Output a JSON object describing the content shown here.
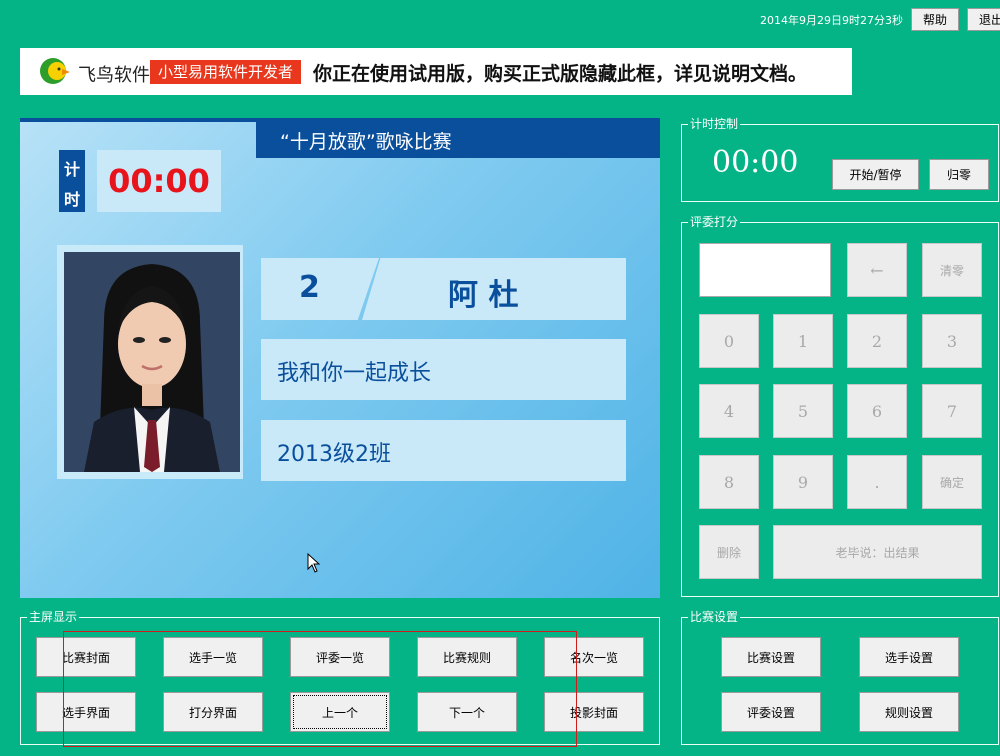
{
  "top": {
    "datetime": "2014年9月29日9时27分3秒",
    "help_label": "帮助",
    "exit_label": "退出"
  },
  "banner": {
    "logo_text": "飞鸟软件",
    "tagline": "小型易用软件开发者",
    "notice": "你正在使用试用版，购买正式版隐藏此框，详见说明文档。"
  },
  "stage": {
    "title": "“十月放歌”歌咏比赛",
    "timer_label_1": "计",
    "timer_label_2": "时",
    "timer_value": "00:00",
    "contestant_number": "2",
    "contestant_name": "阿 杜",
    "song": "我和你一起成长",
    "class": "2013级2班"
  },
  "timer_control": {
    "group_title": "计时控制",
    "display": "00:00",
    "start_pause_label": "开始/暂停",
    "reset_label": "归零"
  },
  "judge_panel": {
    "group_title": "评委打分",
    "score_value": "",
    "backspace": "←",
    "clear": "清零",
    "keys": [
      "0",
      "1",
      "2",
      "3",
      "4",
      "5",
      "6",
      "7",
      "8",
      "9",
      "."
    ],
    "confirm": "确定",
    "delete": "删除",
    "result": "老毕说：出结果"
  },
  "main_display": {
    "group_title": "主屏显示",
    "row1": [
      "比赛封面",
      "选手一览",
      "评委一览",
      "比赛规则",
      "名次一览"
    ],
    "row2": [
      "选手界面",
      "打分界面",
      "上一个",
      "下一个",
      "投影封面"
    ]
  },
  "settings": {
    "group_title": "比赛设置",
    "buttons": [
      "比赛设置",
      "选手设置",
      "评委设置",
      "规则设置"
    ]
  },
  "colors": {
    "background": "#05b486",
    "timer_red": "#e8141c",
    "stage_dark_blue": "#0a4f9c",
    "banner_red": "#e8371d"
  }
}
